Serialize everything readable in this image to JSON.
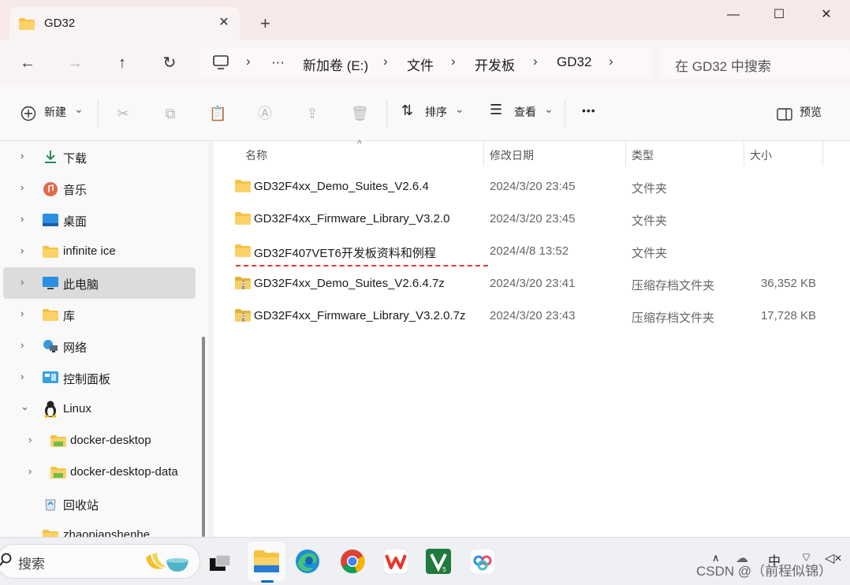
{
  "window": {
    "tab_title": "GD32",
    "tab_close": "✕",
    "new_tab": "+",
    "minimize": "—",
    "maximize": "☐",
    "close": "✕"
  },
  "nav": {
    "back": "←",
    "forward": "→",
    "up": "↑",
    "refresh": "↻",
    "more": "···",
    "breadcrumbs": [
      "新加卷 (E:)",
      "文件",
      "开发板",
      "GD32"
    ],
    "chevron": "›",
    "search_placeholder": "在 GD32 中搜索"
  },
  "toolbar": {
    "new_label": "新建",
    "sort_label": "排序",
    "view_label": "查看",
    "more_label": "•••",
    "preview_label": "预览",
    "dropdown": "⌄"
  },
  "sidebar": {
    "items": [
      {
        "label": "下载",
        "icon": "download-icon"
      },
      {
        "label": "音乐",
        "icon": "music-icon"
      },
      {
        "label": "桌面",
        "icon": "desktop-icon"
      },
      {
        "label": "infinite ice",
        "icon": "folder-icon"
      },
      {
        "label": "此电脑",
        "icon": "computer-icon"
      },
      {
        "label": "库",
        "icon": "library-icon"
      },
      {
        "label": "网络",
        "icon": "network-icon"
      },
      {
        "label": "控制面板",
        "icon": "control-panel-icon"
      },
      {
        "label": "Linux",
        "icon": "linux-icon"
      },
      {
        "label": "docker-desktop",
        "icon": "folder-icon"
      },
      {
        "label": "docker-desktop-data",
        "icon": "folder-icon"
      },
      {
        "label": "回收站",
        "icon": "recycle-bin-icon"
      },
      {
        "label": "zhaopianshenhe",
        "icon": "folder-icon"
      }
    ],
    "arrow_collapsed": "›",
    "arrow_expanded": "⌄"
  },
  "columns": {
    "name": "名称",
    "modified": "修改日期",
    "type": "类型",
    "size": "大小",
    "sort_caret": "^"
  },
  "files": [
    {
      "name": "GD32F4xx_Demo_Suites_V2.6.4",
      "modified": "2024/3/20 23:45",
      "type": "文件夹",
      "size": "",
      "kind": "folder"
    },
    {
      "name": "GD32F4xx_Firmware_Library_V3.2.0",
      "modified": "2024/3/20 23:45",
      "type": "文件夹",
      "size": "",
      "kind": "folder"
    },
    {
      "name": "GD32F407VET6开发板资料和例程",
      "modified": "2024/4/8 13:52",
      "type": "文件夹",
      "size": "",
      "kind": "folder"
    },
    {
      "name": "GD32F4xx_Demo_Suites_V2.6.4.7z",
      "modified": "2024/3/20 23:41",
      "type": "压缩存档文件夹",
      "size": "36,352 KB",
      "kind": "zip"
    },
    {
      "name": "GD32F4xx_Firmware_Library_V3.2.0.7z",
      "modified": "2024/3/20 23:43",
      "type": "压缩存档文件夹",
      "size": "17,728 KB",
      "kind": "zip"
    }
  ],
  "taskbar": {
    "search_label": "搜索",
    "ime": "中",
    "watermark": "CSDN @（前程似锦）"
  },
  "colors": {
    "folder": "#f5c242",
    "accent": "#0a64c8",
    "annotation": "#e23b3b"
  }
}
